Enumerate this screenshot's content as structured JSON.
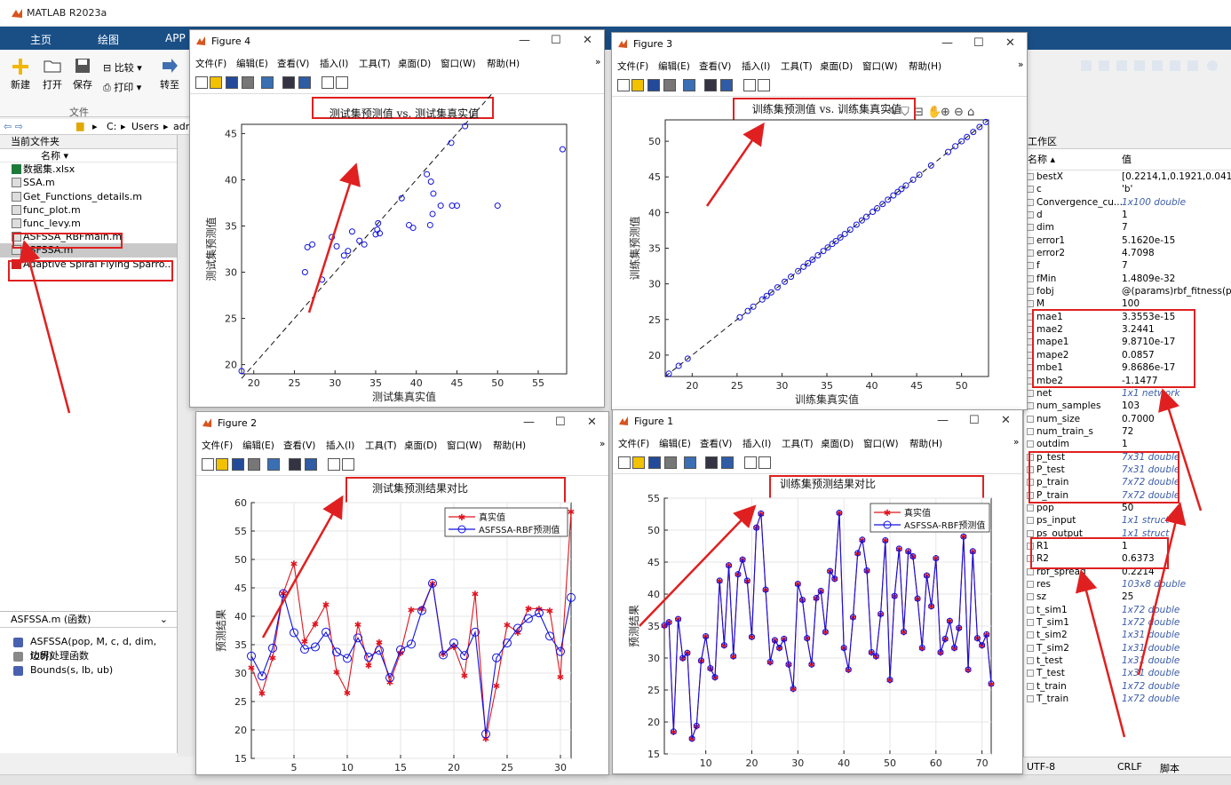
{
  "app": {
    "title": "MATLAB R2023a"
  },
  "ribbon": {
    "tabs": [
      "主页",
      "绘图",
      "APP"
    ],
    "buttons": [
      "新建",
      "打开",
      "保存",
      "比较",
      "打印",
      "转至"
    ],
    "section": "文件"
  },
  "address": {
    "path": [
      "C:",
      "Users",
      "adm"
    ]
  },
  "current_folder": {
    "title": "当前文件夹",
    "column": "名称",
    "files": [
      "数据集.xlsx",
      "SSA.m",
      "Get_Functions_details.m",
      "func_plot.m",
      "func_levy.m",
      "ASFSSA_RBFmain.m",
      "ASFSSA.m",
      "Adaptive Spiral Flying Sparro..."
    ]
  },
  "details": {
    "title": "ASFSSA.m  (函数)",
    "items": [
      "ASFSSA(pop, M, c, d, dim, fobj)",
      "边界处理函数",
      "Bounds(s, lb, ub)"
    ]
  },
  "workspace": {
    "title": "工作区",
    "col_name": "名称",
    "col_value": "值",
    "vars": [
      [
        "bestX",
        "[0.2214,1,0.1921,0.0413,0",
        false
      ],
      [
        "c",
        "'b'",
        false
      ],
      [
        "Convergence_cu...",
        "1x100 double",
        true
      ],
      [
        "d",
        "1",
        false
      ],
      [
        "dim",
        "7",
        false
      ],
      [
        "error1",
        "5.1620e-15",
        false
      ],
      [
        "error2",
        "4.7098",
        false
      ],
      [
        "f",
        "7",
        false
      ],
      [
        "fMin",
        "1.4809e-32",
        false
      ],
      [
        "fobj",
        "@(params)rbf_fitness(pa",
        false
      ],
      [
        "M",
        "100",
        false
      ],
      [
        "mae1",
        "3.3553e-15",
        false
      ],
      [
        "mae2",
        "3.2441",
        false
      ],
      [
        "mape1",
        "9.8710e-17",
        false
      ],
      [
        "mape2",
        "0.0857",
        false
      ],
      [
        "mbe1",
        "9.8686e-17",
        false
      ],
      [
        "mbe2",
        "-1.1477",
        false
      ],
      [
        "net",
        "1x1 network",
        true
      ],
      [
        "num_samples",
        "103",
        false
      ],
      [
        "num_size",
        "0.7000",
        false
      ],
      [
        "num_train_s",
        "72",
        false
      ],
      [
        "outdim",
        "1",
        false
      ],
      [
        "p_test",
        "7x31 double",
        true
      ],
      [
        "P_test",
        "7x31 double",
        true
      ],
      [
        "p_train",
        "7x72 double",
        true
      ],
      [
        "P_train",
        "7x72 double",
        true
      ],
      [
        "pop",
        "50",
        false
      ],
      [
        "ps_input",
        "1x1 struct",
        true
      ],
      [
        "ps_output",
        "1x1 struct",
        true
      ],
      [
        "R1",
        "1",
        false
      ],
      [
        "R2",
        "0.6373",
        false
      ],
      [
        "rbf_spread",
        "0.2214",
        false
      ],
      [
        "res",
        "103x8 double",
        true
      ],
      [
        "sz",
        "25",
        false
      ],
      [
        "t_sim1",
        "1x72 double",
        true
      ],
      [
        "T_sim1",
        "1x72 double",
        true
      ],
      [
        "t_sim2",
        "1x31 double",
        true
      ],
      [
        "T_sim2",
        "1x31 double",
        true
      ],
      [
        "t_test",
        "1x31 double",
        true
      ],
      [
        "T_test",
        "1x31 double",
        true
      ],
      [
        "t_train",
        "1x72 double",
        true
      ],
      [
        "T_train",
        "1x72 double",
        true
      ]
    ]
  },
  "status": {
    "encoding": "UTF-8",
    "eol": "CRLF",
    "type": "脚本"
  },
  "menus": [
    "文件(F)",
    "编辑(E)",
    "查看(V)",
    "插入(I)",
    "工具(T)",
    "桌面(D)",
    "窗口(W)",
    "帮助(H)"
  ],
  "fig4": {
    "title": "Figure 4"
  },
  "fig3": {
    "title": "Figure 3"
  },
  "fig2": {
    "title": "Figure 2"
  },
  "fig1": {
    "title": "Figure 1"
  },
  "chart_data": [
    {
      "type": "scatter",
      "title": "测试集预测值 vs. 测试集真实值",
      "xlabel": "测试集真实值",
      "ylabel": "测试集预测值",
      "xlim": [
        18.5,
        58.5
      ],
      "ylim": [
        19,
        46
      ],
      "xticks": [
        20,
        25,
        30,
        35,
        40,
        45,
        50,
        55
      ],
      "yticks": [
        20,
        25,
        30,
        35,
        40,
        45
      ],
      "x": [
        18.5,
        26.3,
        26.6,
        27.2,
        28.4,
        29.6,
        30.2,
        31.1,
        31.6,
        32.1,
        33.0,
        33.6,
        35.0,
        35.2,
        35.3,
        35.5,
        38.2,
        39.1,
        39.6,
        41.3,
        41.7,
        41.8,
        42.1,
        42.0,
        43.0,
        44.4,
        45.0,
        46.0,
        44.3,
        50.0,
        58.0
      ],
      "y": [
        19.3,
        30.0,
        32.7,
        33.0,
        29.2,
        33.8,
        32.8,
        31.8,
        32.3,
        34.4,
        33.4,
        33.0,
        34.1,
        34.6,
        35.3,
        34.2,
        38.0,
        35.1,
        34.8,
        40.6,
        35.1,
        39.8,
        38.5,
        36.3,
        37.2,
        37.2,
        37.2,
        45.8,
        44.0,
        37.2,
        43.3
      ],
      "ref_line": [
        [
          18.5,
          18.5
        ],
        [
          58.5,
          58.5
        ]
      ]
    },
    {
      "type": "scatter",
      "title": "训练集预测值 vs. 训练集真实值",
      "xlabel": "训练集真实值",
      "ylabel": "训练集预测值",
      "xlim": [
        17,
        53
      ],
      "ylim": [
        17,
        53
      ],
      "xticks": [
        20,
        25,
        30,
        35,
        40,
        45,
        50
      ],
      "yticks": [
        20,
        25,
        30,
        35,
        40,
        45,
        50
      ],
      "x": [
        17.4,
        18.5,
        19.5,
        25.3,
        26.2,
        26.8,
        27.8,
        28.3,
        28.8,
        29.5,
        30.3,
        31.0,
        31.8,
        32.4,
        32.9,
        33.4,
        34.0,
        34.6,
        35.1,
        35.6,
        36.0,
        36.5,
        37.0,
        37.6,
        38.3,
        38.9,
        39.4,
        40.1,
        40.6,
        41.2,
        41.8,
        42.4,
        42.9,
        43.3,
        43.8,
        44.6,
        45.3,
        46.6,
        48.5,
        49.3,
        50.0,
        50.6,
        51.3,
        52.0,
        52.7
      ],
      "y": [
        17.4,
        18.5,
        19.5,
        25.3,
        26.2,
        26.8,
        27.8,
        28.3,
        28.8,
        29.5,
        30.3,
        31.0,
        31.8,
        32.4,
        32.9,
        33.4,
        34.0,
        34.6,
        35.1,
        35.6,
        36.0,
        36.5,
        37.0,
        37.6,
        38.3,
        38.9,
        39.4,
        40.1,
        40.6,
        41.2,
        41.8,
        42.4,
        42.9,
        43.3,
        43.8,
        44.6,
        45.3,
        46.6,
        48.5,
        49.3,
        50.0,
        50.6,
        51.3,
        52.0,
        52.7
      ],
      "ref_line": [
        [
          17,
          17
        ],
        [
          53,
          53
        ]
      ]
    },
    {
      "type": "line",
      "title": "测试集预测结果对比",
      "xlabel": "",
      "ylabel": "预测结果",
      "xlim": [
        1,
        31
      ],
      "ylim": [
        15,
        60
      ],
      "xticks": [
        5,
        10,
        15,
        20,
        25,
        30
      ],
      "yticks": [
        15,
        20,
        25,
        30,
        35,
        40,
        45,
        50,
        55,
        60
      ],
      "series": [
        {
          "name": "真实值",
          "color": "#e0141e",
          "marker": "star",
          "values": [
            31.0,
            26.5,
            32.7,
            44.1,
            49.3,
            35.6,
            38.7,
            42.1,
            30.2,
            26.6,
            38.6,
            31.4,
            35.5,
            28.4,
            33.6,
            41.2,
            41.3,
            45.8,
            33.4,
            34.7,
            29.6,
            44.0,
            18.5,
            27.8,
            38.5,
            37.2,
            41.4,
            41.3,
            41.0,
            29.4,
            58.4
          ]
        },
        {
          "name": "ASFSSA-RBF预测值",
          "color": "#1010e0",
          "marker": "circle",
          "values": [
            33.0,
            29.5,
            34.4,
            44.0,
            37.1,
            34.2,
            34.6,
            37.2,
            33.7,
            32.6,
            36.2,
            32.8,
            34.0,
            29.2,
            34.1,
            35.1,
            41.0,
            45.8,
            33.2,
            35.3,
            33.1,
            37.2,
            19.3,
            32.7,
            35.3,
            37.9,
            39.6,
            40.6,
            36.5,
            33.8,
            43.3
          ]
        }
      ]
    },
    {
      "type": "line",
      "title": "训练集预测结果对比",
      "xlabel": "",
      "ylabel": "预测结果",
      "xlim": [
        1,
        72
      ],
      "ylim": [
        15,
        55
      ],
      "xticks": [
        10,
        20,
        30,
        40,
        50,
        60,
        70
      ],
      "yticks": [
        15,
        20,
        25,
        30,
        35,
        40,
        45,
        50,
        55
      ],
      "series": [
        {
          "name": "真实值",
          "color": "#e0141e",
          "marker": "star",
          "values": [
            35.1,
            35.6,
            18.5,
            36.1,
            30.0,
            30.8,
            17.4,
            19.4,
            29.6,
            33.4,
            28.4,
            27.0,
            42.1,
            32.0,
            44.5,
            30.3,
            43.1,
            45.4,
            42.1,
            33.3,
            50.4,
            52.6,
            40.7,
            29.4,
            32.8,
            31.6,
            33.0,
            29.0,
            25.2,
            41.6,
            39.1,
            33.1,
            29.0,
            39.4,
            40.5,
            34.1,
            43.6,
            42.4,
            52.7,
            31.6,
            28.2,
            36.4,
            46.4,
            48.5,
            43.7,
            30.9,
            30.3,
            36.9,
            48.4,
            26.6,
            39.7,
            47.1,
            34.1,
            46.7,
            45.9,
            39.3,
            31.6,
            42.9,
            38.1,
            45.6,
            30.9,
            33.0,
            35.8,
            31.6,
            34.7,
            49.0,
            28.2,
            46.7,
            33.1,
            32.0,
            33.7,
            26.0
          ]
        },
        {
          "name": "ASFSSA-RBF预测值",
          "color": "#1010e0",
          "marker": "circle",
          "values": [
            35.1,
            35.6,
            18.5,
            36.1,
            30.0,
            30.8,
            17.4,
            19.4,
            29.6,
            33.4,
            28.4,
            27.0,
            42.1,
            32.0,
            44.5,
            30.3,
            43.1,
            45.4,
            42.1,
            33.3,
            50.4,
            52.6,
            40.7,
            29.4,
            32.8,
            31.6,
            33.0,
            29.0,
            25.2,
            41.6,
            39.1,
            33.1,
            29.0,
            39.4,
            40.5,
            34.1,
            43.6,
            42.4,
            52.7,
            31.6,
            28.2,
            36.4,
            46.4,
            48.5,
            43.7,
            30.9,
            30.3,
            36.9,
            48.4,
            26.6,
            39.7,
            47.1,
            34.1,
            46.7,
            45.9,
            39.3,
            31.6,
            42.9,
            38.1,
            45.6,
            30.9,
            33.0,
            35.8,
            31.6,
            34.7,
            49.0,
            28.2,
            46.7,
            33.1,
            32.0,
            33.7,
            26.0
          ]
        }
      ]
    }
  ]
}
